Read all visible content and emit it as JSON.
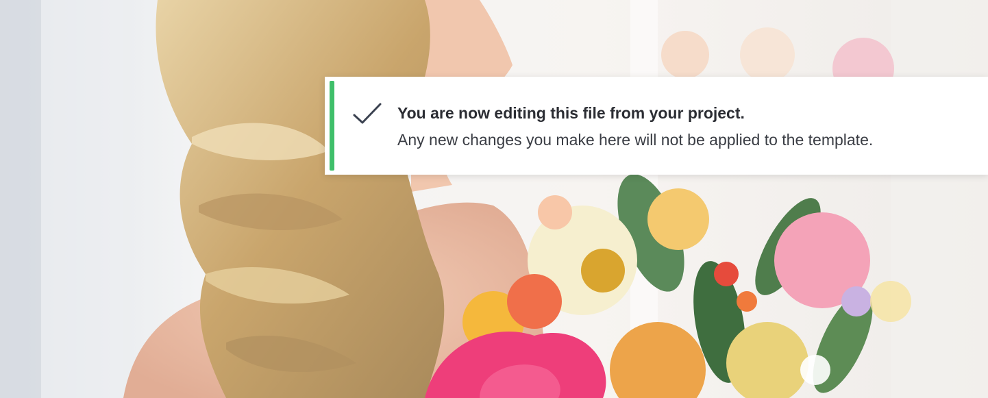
{
  "background": {
    "image_subject": "woman-with-flower-bouquet"
  },
  "toast": {
    "type": "success",
    "icon": "check-icon",
    "title": "You are now editing this file from your project.",
    "message": "Any new changes you make here will not be applied to the template.",
    "accent_color": "#3fbf6a",
    "background_color": "#ffffff"
  }
}
